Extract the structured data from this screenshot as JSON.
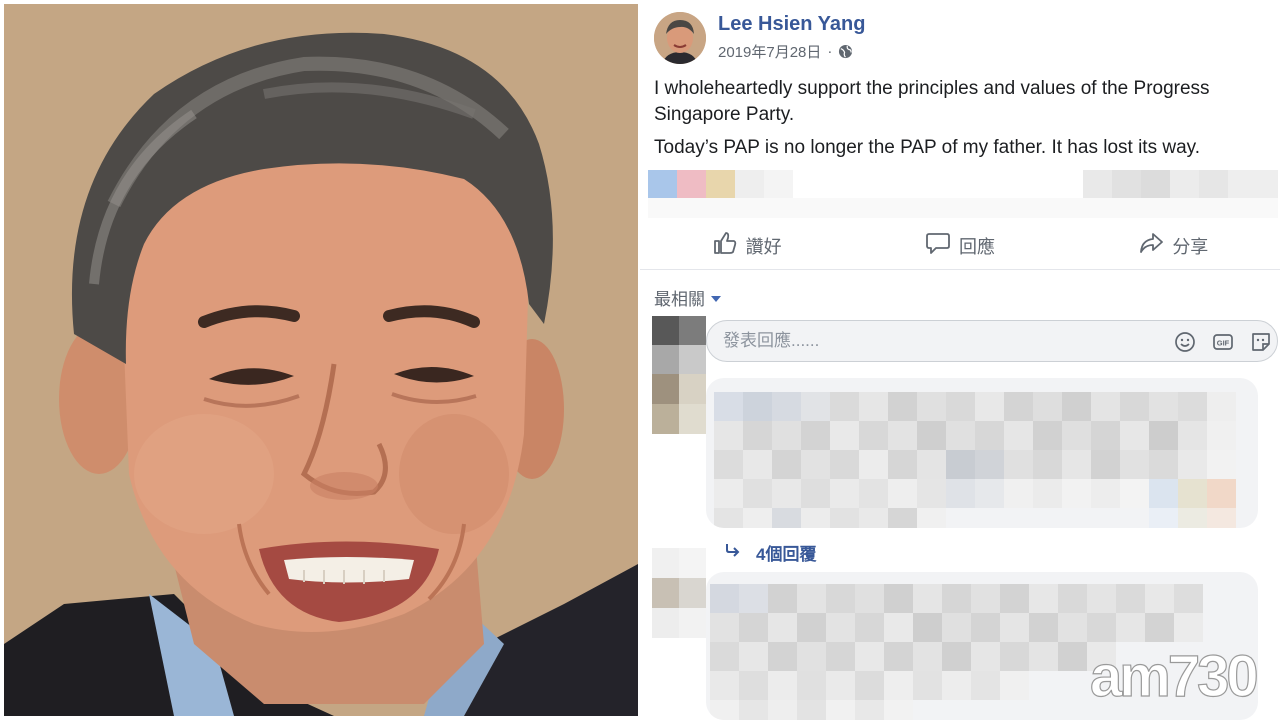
{
  "post": {
    "author": "Lee Hsien Yang",
    "date": "2019年7月28日",
    "separator": "·",
    "privacy_icon": "globe-icon",
    "paragraphs": [
      "I wholeheartedly support the principles and values of the Progress Singapore Party.",
      "Today’s PAP is no longer the PAP of my father. It has lost its way."
    ]
  },
  "actions": {
    "like": {
      "label": "讚好",
      "icon": "thumbs-up-icon"
    },
    "comment": {
      "label": "回應",
      "icon": "speech-bubble-icon"
    },
    "share": {
      "label": "分享",
      "icon": "share-arrow-icon"
    }
  },
  "comments": {
    "sort_label": "最相關",
    "input_placeholder": "發表回應......",
    "input_icons": [
      "emoji-icon",
      "gif-icon",
      "sticker-icon"
    ],
    "replies_label": "4個回覆"
  },
  "watermark": {
    "text": "am730"
  },
  "colors": {
    "link_blue": "#385898",
    "secondary_text": "#606770",
    "bubble_bg": "#f2f3f5",
    "watermark": "#ffffff"
  }
}
